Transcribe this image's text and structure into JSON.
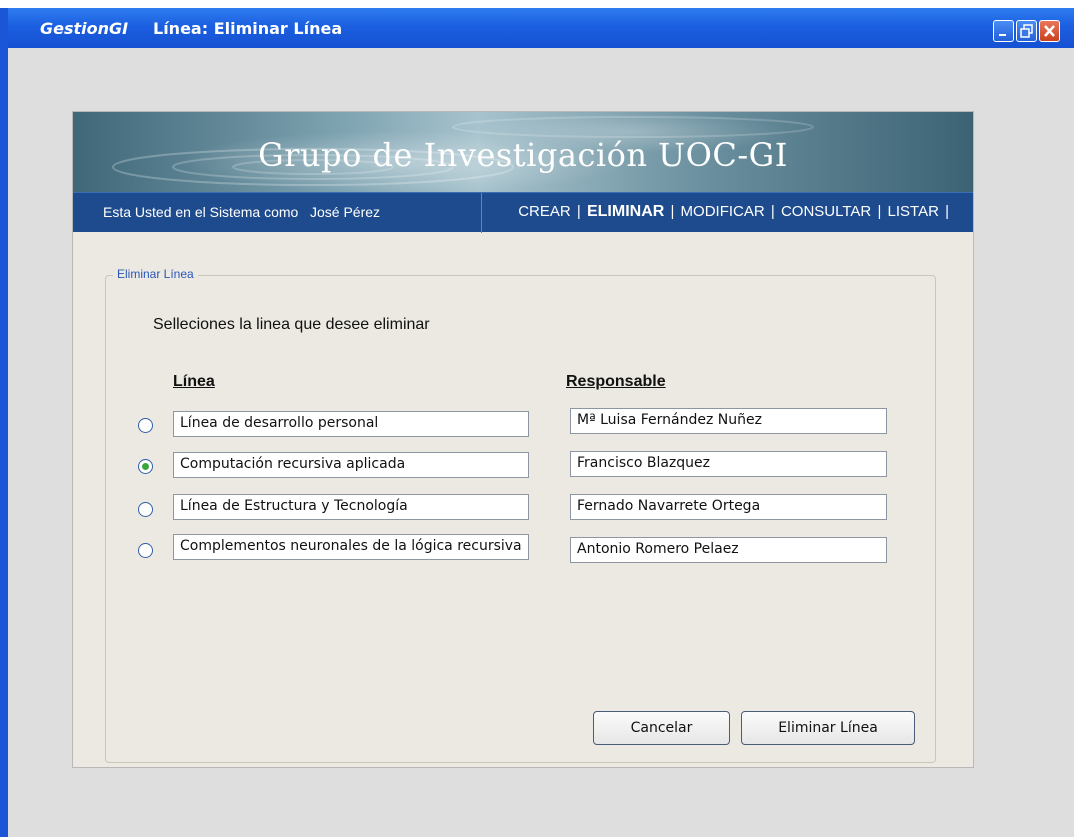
{
  "window": {
    "app_name": "GestionGI",
    "title": "Línea: Eliminar Línea",
    "controls": [
      "minimize-icon",
      "restore-icon",
      "close-icon"
    ]
  },
  "header": {
    "title": "Grupo de Investigación UOC-GI"
  },
  "navbar": {
    "user_text": "Esta Usted en el Sistema como   José Pérez",
    "menu": {
      "crear": "CREAR",
      "eliminar": "ELIMINAR",
      "modificar": "MODIFICAR",
      "consultar": "CONSULTAR",
      "listar": "LISTAR",
      "separator": "|",
      "active": "ELIMINAR"
    }
  },
  "form": {
    "legend": "Eliminar Línea",
    "prompt": "Selleciones la linea que desee eliminar",
    "col_linea": "Línea",
    "col_responsable": "Responsable",
    "rows": [
      {
        "linea": "Línea de desarrollo personal",
        "responsable": "Mª Luisa Fernández Nuñez",
        "selected": false
      },
      {
        "linea": "Computación recursiva aplicada",
        "responsable": "Francisco Blazquez",
        "selected": true
      },
      {
        "linea": "Línea de Estructura y Tecnología",
        "responsable": "Fernado Navarrete Ortega",
        "selected": false
      },
      {
        "linea": "Complementos neuronales de la lógica recursiva",
        "responsable": "Antonio Romero Pelaez",
        "selected": false
      }
    ],
    "cancel_label": "Cancelar",
    "delete_label": "Eliminar Línea"
  },
  "colors": {
    "titlebar": "#1b5fe0",
    "navbar": "#1e4b8e",
    "panel": "#ece9e2",
    "legend_text": "#2b57b8",
    "radio_checked": "#3aa53a"
  }
}
